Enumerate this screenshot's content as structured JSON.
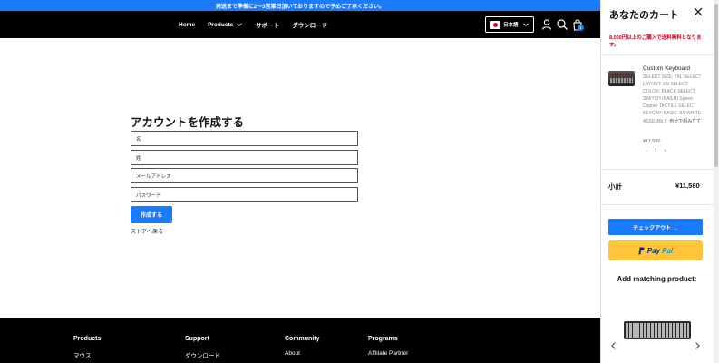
{
  "announcement": "発送まで準備に2～3営業日頂いておりますので予めご了承ください。",
  "nav": {
    "items": [
      {
        "label": "Home"
      },
      {
        "label": "Products",
        "has_dropdown": true
      },
      {
        "label": "サポート"
      },
      {
        "label": "ダウンロード"
      }
    ],
    "language": "日本語"
  },
  "cart_badge_count": "1",
  "form": {
    "title": "アカウントを作成する",
    "fields": [
      {
        "placeholder": "名"
      },
      {
        "placeholder": "姓"
      },
      {
        "placeholder": "メールアドレス"
      },
      {
        "placeholder": "パスワード"
      }
    ],
    "submit_label": "作成する",
    "back_link": "ストアへ戻る"
  },
  "footer": {
    "columns": [
      {
        "heading": "Products",
        "first_link": "マウス"
      },
      {
        "heading": "Support",
        "first_link": "ダウンロード"
      },
      {
        "heading": "Community",
        "first_link": "About"
      },
      {
        "heading": "Programs",
        "first_link": "Affiliate Partner"
      }
    ]
  },
  "cart": {
    "title": "あなたのカート",
    "shipping_note": "8,000円以上のご購入で送料無料となります。",
    "item": {
      "name": "Custom Keyboard",
      "description_prefix": "SELECT SIZE: TKL SELECT LAYOUT: JIS SELECT COLOR: BLACK SELECT SWITCH (KAILH) Speed Copper TACTILE SELECT KEYCAP: BASIC JIS WHITE ASSEMBLY: ",
      "description_suffix": "自分で組み立て",
      "price": "¥11,580",
      "quantity": "1"
    },
    "subtotal_label": "小計",
    "subtotal_value": "¥11,580",
    "checkout_label": "チェックアウト →",
    "paypal_p": "Pay",
    "paypal_pal": "Pal",
    "matching_title": "Add matching product:"
  },
  "colors": {
    "accent": "#1a7bff",
    "paypal_yellow": "#ffc439",
    "warning_red": "#d0021b"
  }
}
